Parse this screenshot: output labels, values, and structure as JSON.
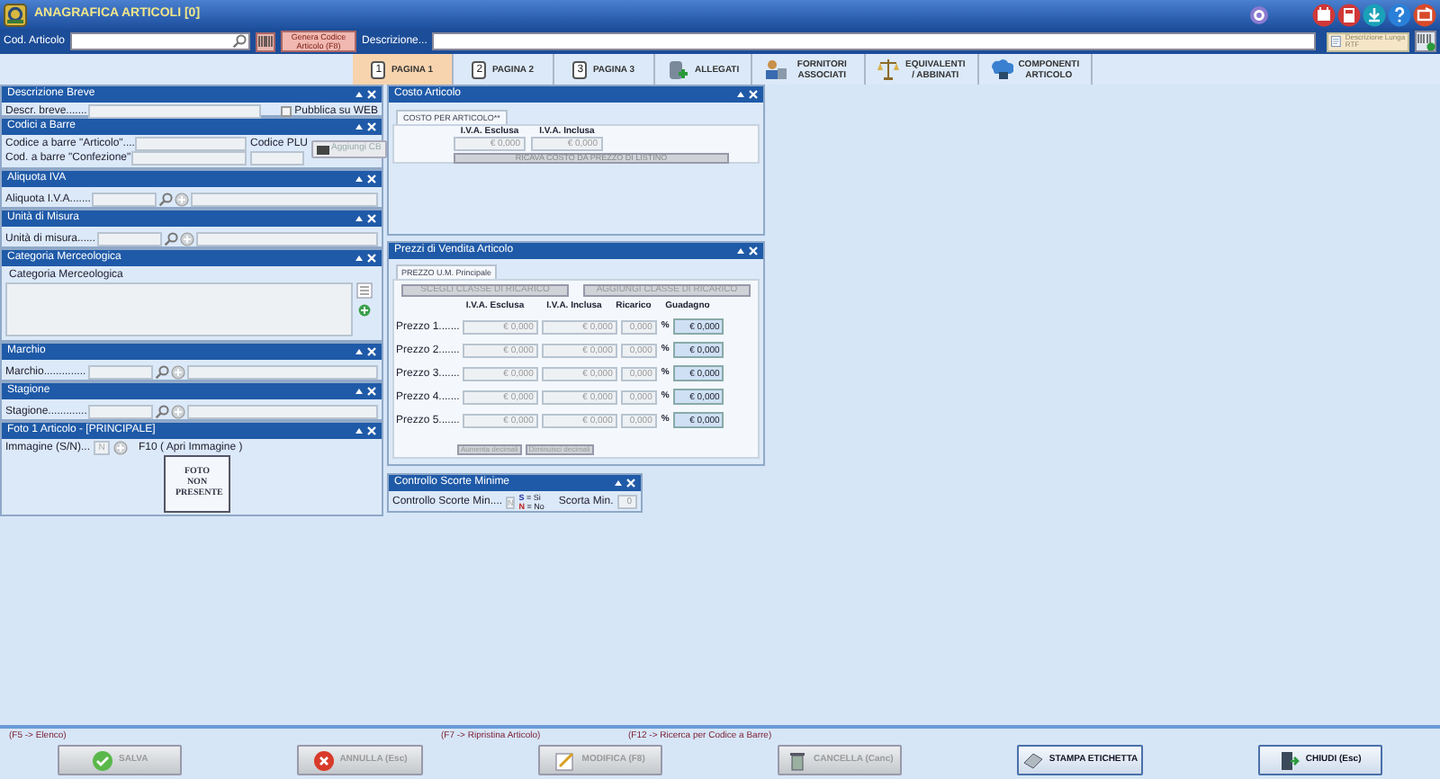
{
  "window": {
    "title": "ANAGRAFICA ARTICOLI [0]"
  },
  "toolbar": {
    "code_label": "Cod. Articolo",
    "generate_button": "Genera Codice Articolo (F8)",
    "description_label": "Descrizione...",
    "long_description_button": "Descrizione Lunga RTF"
  },
  "tabs": [
    {
      "kind": "page",
      "number": "1",
      "label": "PAGINA 1",
      "selected": true
    },
    {
      "kind": "page",
      "number": "2",
      "label": "PAGINA 2",
      "selected": false
    },
    {
      "kind": "page",
      "number": "3",
      "label": "PAGINA 3",
      "selected": false
    },
    {
      "kind": "attachments",
      "label": "ALLEGATI",
      "selected": false
    },
    {
      "kind": "suppliers",
      "label": "FORNITORI ASSOCIATI",
      "selected": false
    },
    {
      "kind": "equivalents",
      "label": "EQUIVALENTI / ABBINATI",
      "selected": false
    },
    {
      "kind": "components",
      "label": "COMPONENTI ARTICOLO",
      "selected": false
    }
  ],
  "left_panels": [
    {
      "kind": "text",
      "title": "Descrizione Breve",
      "label": "Descr. breve.......",
      "checkbox": {
        "label": "Pubblica su WEB",
        "checked": false
      }
    },
    {
      "kind": "barcodes",
      "title": "Codici a Barre",
      "article_label": "Codice a barre \"Articolo\"....",
      "package_label": "Cod. a barre \"Confezione\"",
      "plu_label": "Codice PLU",
      "add_button": "Aggiungi CB"
    },
    {
      "kind": "lookup",
      "title": "Aliquota IVA",
      "label": "Aliquota I.V.A......."
    },
    {
      "kind": "lookup",
      "title": "Unità di Misura",
      "label": "Unità di misura......"
    },
    {
      "kind": "category",
      "title": "Categoria Merceologica",
      "label": "Categoria Merceologica"
    },
    {
      "kind": "lookup",
      "title": "Marchio",
      "label": "Marchio.............."
    },
    {
      "kind": "lookup",
      "title": "Stagione",
      "label": "Stagione............."
    },
    {
      "kind": "photo",
      "title": "Foto 1 Articolo - [PRINCIPALE]",
      "label": "Immagine (S/N)...",
      "value": "N",
      "hint": "F10 ( Apri Immagine )",
      "photo_text": "FOTO NON PRESENTE"
    }
  ],
  "cost": {
    "title": "Costo Articolo",
    "tab": "COSTO PER ARTICOLO**",
    "columns": [
      "I.V.A. Esclusa",
      "I.V.A. Inclusa"
    ],
    "values": [
      "€ 0,000",
      "€ 0,000"
    ],
    "button": "RICAVA COSTO DA PREZZO DI LISTINO"
  },
  "prices": {
    "title": "Prezzi di Vendita Articolo",
    "tab": "PREZZO U.M. Principale",
    "buttons": [
      "SCEGLI CLASSE DI RICARICO",
      "AGGIUNGI CLASSE DI RICARICO"
    ],
    "columns": [
      "I.V.A. Esclusa",
      "I.V.A. Inclusa",
      "Ricarico",
      "Guadagno"
    ],
    "rows": [
      {
        "label": "Prezzo 1.......",
        "excl": "€ 0,000",
        "incl": "€ 0,000",
        "markup": "0,000",
        "unit": "%",
        "profit": "€ 0,000"
      },
      {
        "label": "Prezzo 2.......",
        "excl": "€ 0,000",
        "incl": "€ 0,000",
        "markup": "0,000",
        "unit": "%",
        "profit": "€ 0,000"
      },
      {
        "label": "Prezzo 3.......",
        "excl": "€ 0,000",
        "incl": "€ 0,000",
        "markup": "0,000",
        "unit": "%",
        "profit": "€ 0,000"
      },
      {
        "label": "Prezzo 4.......",
        "excl": "€ 0,000",
        "incl": "€ 0,000",
        "markup": "0,000",
        "unit": "%",
        "profit": "€ 0,000"
      },
      {
        "label": "Prezzo 5.......",
        "excl": "€ 0,000",
        "incl": "€ 0,000",
        "markup": "0,000",
        "unit": "%",
        "profit": "€ 0,000"
      }
    ],
    "decimal_buttons": [
      "Aumenta decimali",
      "Diminuisci decimali"
    ]
  },
  "stock": {
    "title": "Controllo Scorte Minime",
    "label": "Controllo Scorte Min....",
    "value": "N",
    "legend": [
      {
        "key": "S",
        "text": "= Si"
      },
      {
        "key": "N",
        "text": "= No"
      }
    ],
    "min_label": "Scorta Min.",
    "min_value": "0"
  },
  "footer": {
    "hints": [
      "(F5 -> Elenco)",
      "(F7 -> Ripristina Articolo)",
      "(F12 -> Ricerca per Codice a Barre)"
    ],
    "buttons": [
      {
        "kind": "save",
        "label": "SALVA",
        "disabled": true
      },
      {
        "kind": "cancel",
        "label": "ANNULLA (Esc)",
        "disabled": true
      },
      {
        "kind": "edit",
        "label": "MODIFICA (F8)",
        "disabled": true
      },
      {
        "kind": "delete",
        "label": "CANCELLA (Canc)",
        "disabled": true
      },
      {
        "kind": "print",
        "label": "STAMPA ETICHETTA",
        "disabled": false
      },
      {
        "kind": "close",
        "label": "CHIUDI (Esc)",
        "disabled": false
      }
    ]
  }
}
